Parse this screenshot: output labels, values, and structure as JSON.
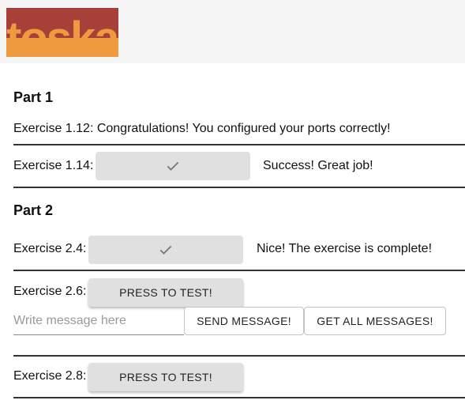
{
  "part1": {
    "title": "Part 1",
    "ex112": {
      "label": "Exercise 1.12: Congratulations! You configured your ports correctly!"
    },
    "ex114": {
      "label": "Exercise 1.14:",
      "status": "Success! Great job!"
    }
  },
  "part2": {
    "title": "Part 2",
    "ex24": {
      "label": "Exercise 2.4:",
      "status": "Nice! The exercise is complete!"
    },
    "ex26": {
      "label": "Exercise 2.6:",
      "button": "PRESS TO TEST!",
      "input_placeholder": "Write message here",
      "send_button": "SEND MESSAGE!",
      "get_all_button": "GET ALL MESSAGES!"
    },
    "ex28": {
      "label": "Exercise 2.8:",
      "button": "PRESS TO TEST!"
    }
  },
  "colors": {
    "logo_dark": "#a8403a",
    "logo_light": "#ee9a3f",
    "button_bg": "#e0e0e0",
    "divider": "#333333"
  },
  "icons": [
    "checkmark-icon"
  ]
}
